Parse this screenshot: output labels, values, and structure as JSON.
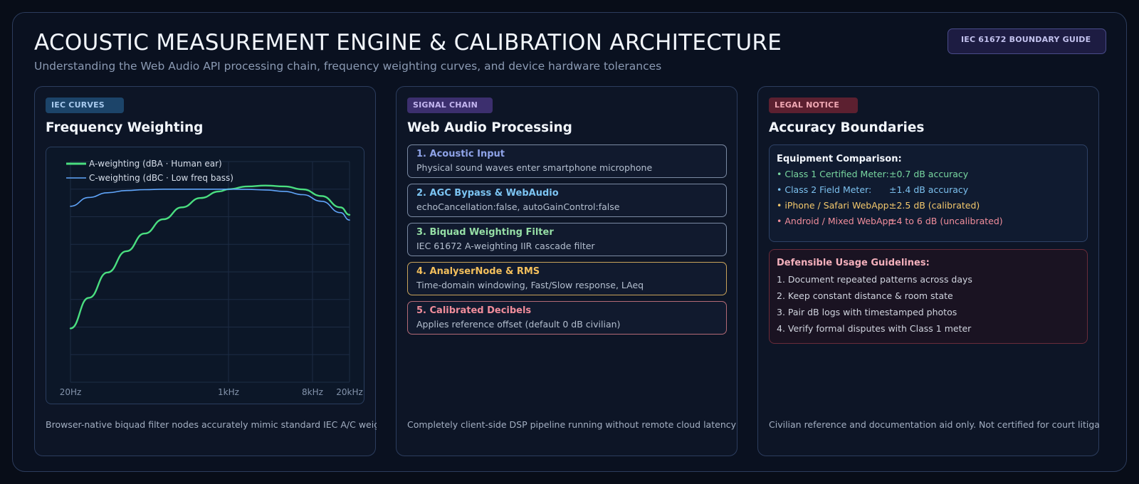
{
  "header": {
    "title": "ACOUSTIC MEASUREMENT ENGINE & CALIBRATION ARCHITECTURE",
    "subtitle": "Understanding the Web Audio API processing chain, frequency weighting curves, and device hardware tolerances",
    "guide_button": "IEC 61672 BOUNDARY GUIDE"
  },
  "panels": {
    "weighting": {
      "tag": "IEC CURVES",
      "title": "Frequency Weighting",
      "footnote": "Browser-native biquad filter nodes accurately mimic standard IEC A/C weighting"
    },
    "signal": {
      "tag": "SIGNAL CHAIN",
      "title": "Web Audio Processing",
      "footnote": "Completely client-side DSP pipeline running without remote cloud latency or privacy",
      "steps": [
        {
          "head": "1. Acoustic Input",
          "desc": "Physical sound waves enter smartphone microphone"
        },
        {
          "head": "2. AGC Bypass & WebAudio",
          "desc": "echoCancellation:false, autoGainControl:false"
        },
        {
          "head": "3. Biquad Weighting Filter",
          "desc": "IEC 61672 A-weighting IIR cascade filter"
        },
        {
          "head": "4. AnalyserNode & RMS",
          "desc": "Time-domain windowing, Fast/Slow response, LAeq"
        },
        {
          "head": "5. Calibrated Decibels",
          "desc": "Applies reference offset (default 0 dB civilian)"
        }
      ]
    },
    "accuracy": {
      "tag": "LEGAL NOTICE",
      "title": "Accuracy Boundaries",
      "footnote": "Civilian reference and documentation aid only. Not certified for court litigation.",
      "equipment_title": "Equipment Comparison:",
      "equipment": [
        {
          "name": "• Class 1 Certified Meter:",
          "value": "±0.7 dB accuracy"
        },
        {
          "name": "• Class 2 Field Meter:",
          "value": "±1.4 dB accuracy"
        },
        {
          "name": "• iPhone / Safari WebApp:",
          "value": "±2.5 dB (calibrated)"
        },
        {
          "name": "• Android / Mixed WebApp:",
          "value": "±4 to 6 dB (uncalibrated)"
        }
      ],
      "guidelines_title": "Defensible Usage Guidelines:",
      "guidelines": [
        "1. Document repeated patterns across days",
        "2. Keep constant distance & room state",
        "3. Pair dB logs with timestamped photos",
        "4. Verify formal disputes with Class 1 meter"
      ]
    }
  },
  "colors": {
    "a_weighting": "#4ade80",
    "c_weighting": "#60a5fa",
    "grid": "#1d2c45"
  },
  "chart_data": {
    "type": "line",
    "x_scale": "log",
    "xlim_hz": [
      20,
      20000
    ],
    "tick_labels": [
      "20Hz",
      "1kHz",
      "8kHz",
      "20kHz"
    ],
    "tick_values_hz": [
      20,
      1000,
      8000,
      20000
    ],
    "ylim_db": [
      -70,
      10
    ],
    "grid": true,
    "legend": "top-left",
    "series": [
      {
        "name": "A-weighting (dBA · Human ear)",
        "x_hz": [
          20,
          31.5,
          50,
          80,
          125,
          200,
          315,
          500,
          800,
          1000,
          1600,
          2500,
          4000,
          6300,
          10000,
          16000,
          20000
        ],
        "y_db": [
          -50.5,
          -39.4,
          -30.2,
          -22.5,
          -16.1,
          -10.9,
          -6.6,
          -3.2,
          -0.8,
          0,
          1.0,
          1.3,
          1.0,
          -0.1,
          -2.5,
          -6.6,
          -9.3
        ]
      },
      {
        "name": "C-weighting (dBC · Low freq bass)",
        "x_hz": [
          20,
          31.5,
          50,
          80,
          125,
          200,
          315,
          500,
          800,
          1000,
          1600,
          2500,
          4000,
          6300,
          10000,
          16000,
          20000
        ],
        "y_db": [
          -6.2,
          -3.0,
          -1.3,
          -0.5,
          -0.2,
          0,
          0,
          0,
          0,
          0,
          -0.1,
          -0.3,
          -0.8,
          -2.0,
          -4.4,
          -8.5,
          -11.2
        ]
      }
    ]
  }
}
